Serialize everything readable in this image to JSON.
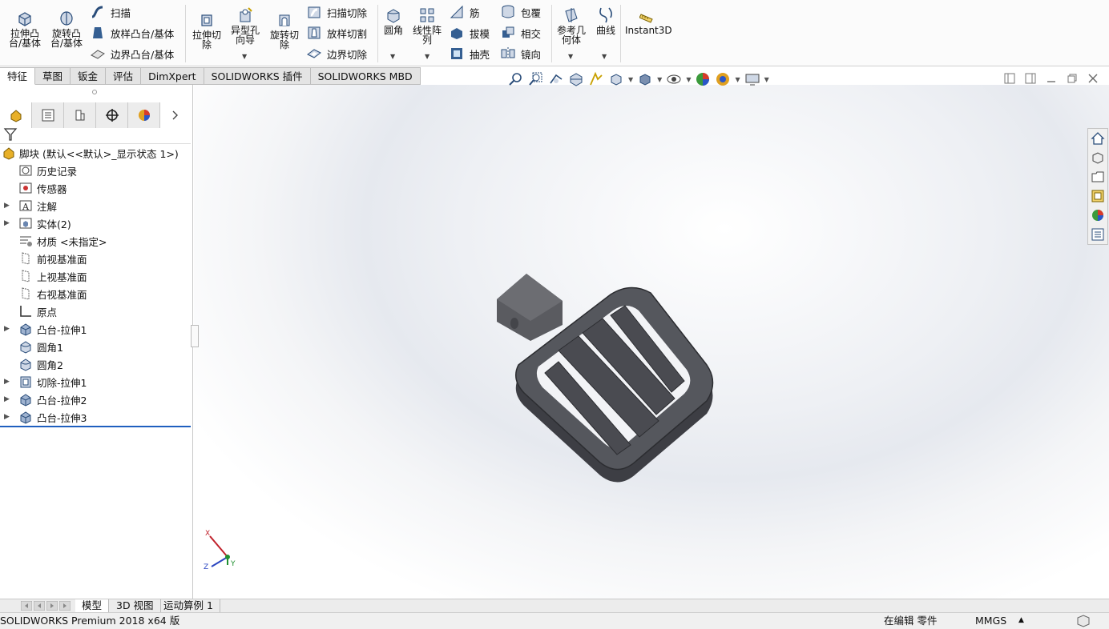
{
  "ribbon": {
    "extrude_boss": "拉伸凸\n台/基体",
    "revolve_boss": "旋转凸\n台/基体",
    "sweep": "扫描",
    "loft_boss": "放样凸台/基体",
    "boundary_boss": "边界凸台/基体",
    "extrude_cut": "拉伸切\n除",
    "hole_wizard": "异型孔\n向导",
    "revolve_cut": "旋转切\n除",
    "swept_cut": "扫描切除",
    "lofted_cut": "放样切割",
    "boundary_cut": "边界切除",
    "fillet": "圆角",
    "linear_pattern": "线性阵\n列",
    "rib": "筋",
    "draft": "拔模",
    "shell": "抽壳",
    "wrap": "包覆",
    "intersect": "相交",
    "mirror": "镜向",
    "ref_geometry": "参考几\n何体",
    "curves": "曲线",
    "instant3d": "Instant3D"
  },
  "tabs": [
    {
      "label": "特征",
      "active": true
    },
    {
      "label": "草图"
    },
    {
      "label": "钣金"
    },
    {
      "label": "评估"
    },
    {
      "label": "DimXpert"
    },
    {
      "label": "SOLIDWORKS 插件"
    },
    {
      "label": "SOLIDWORKS MBD"
    }
  ],
  "tree": {
    "root": "脚块  (默认<<默认>_显示状态 1>)",
    "items": [
      {
        "label": "历史记录",
        "expand": false,
        "icon": "history-icon"
      },
      {
        "label": "传感器",
        "expand": false,
        "icon": "sensor-icon"
      },
      {
        "label": "注解",
        "expand": true,
        "icon": "annotation-icon"
      },
      {
        "label": "实体(2)",
        "expand": true,
        "icon": "solid-bodies-icon"
      },
      {
        "label": "材质 <未指定>",
        "expand": false,
        "icon": "material-icon"
      },
      {
        "label": "前视基准面",
        "expand": false,
        "icon": "plane-icon"
      },
      {
        "label": "上视基准面",
        "expand": false,
        "icon": "plane-icon"
      },
      {
        "label": "右视基准面",
        "expand": false,
        "icon": "plane-icon"
      },
      {
        "label": "原点",
        "expand": false,
        "icon": "origin-icon"
      },
      {
        "label": "凸台-拉伸1",
        "expand": true,
        "icon": "boss-extrude-icon"
      },
      {
        "label": "圆角1",
        "expand": false,
        "icon": "fillet-icon"
      },
      {
        "label": "圆角2",
        "expand": false,
        "icon": "fillet-icon"
      },
      {
        "label": "切除-拉伸1",
        "expand": true,
        "icon": "cut-extrude-icon"
      },
      {
        "label": "凸台-拉伸2",
        "expand": true,
        "icon": "boss-extrude-icon"
      },
      {
        "label": "凸台-拉伸3",
        "expand": true,
        "icon": "boss-extrude-icon"
      }
    ]
  },
  "triad": {
    "x": "X",
    "y": "Y",
    "z": "Z"
  },
  "bottom_tabs": {
    "model": "模型",
    "view3d": "3D 视图",
    "motion": "运动算例 1"
  },
  "status": {
    "product": "SOLIDWORKS Premium 2018 x64 版",
    "mode": "在编辑 零件",
    "units": "MMGS"
  },
  "colors": {
    "accent": "#1f5fbf",
    "part": "#55575d"
  }
}
